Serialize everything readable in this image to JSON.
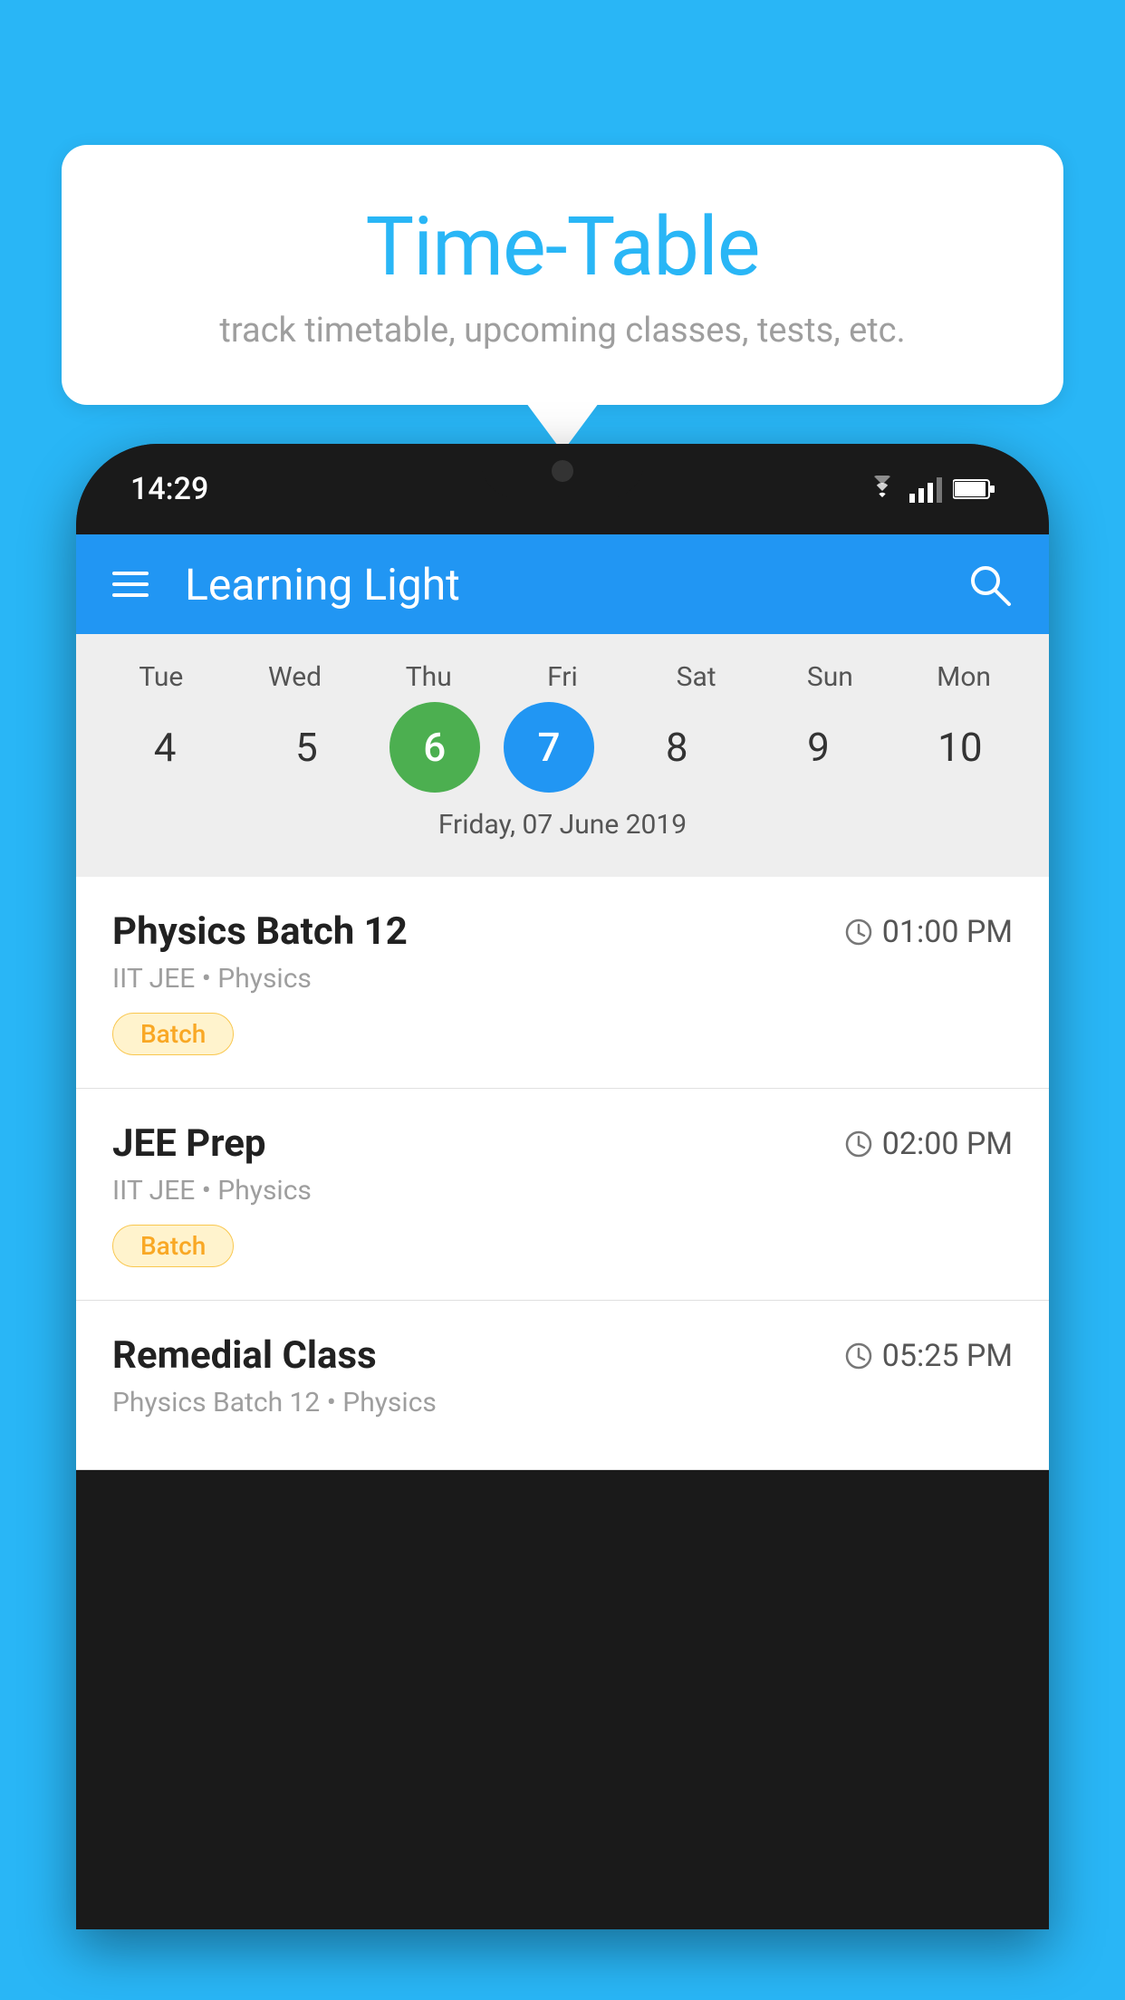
{
  "background_color": "#29B6F6",
  "bubble": {
    "title": "Time-Table",
    "subtitle": "track timetable, upcoming classes, tests, etc."
  },
  "phone": {
    "status_bar": {
      "time": "14:29"
    },
    "app_header": {
      "title": "Learning Light"
    },
    "calendar": {
      "days": [
        {
          "label": "Tue",
          "num": "4",
          "state": "normal"
        },
        {
          "label": "Wed",
          "num": "5",
          "state": "normal"
        },
        {
          "label": "Thu",
          "num": "6",
          "state": "today"
        },
        {
          "label": "Fri",
          "num": "7",
          "state": "selected"
        },
        {
          "label": "Sat",
          "num": "8",
          "state": "normal"
        },
        {
          "label": "Sun",
          "num": "9",
          "state": "normal"
        },
        {
          "label": "Mon",
          "num": "10",
          "state": "normal"
        }
      ],
      "selected_date_label": "Friday, 07 June 2019"
    },
    "schedule": [
      {
        "title": "Physics Batch 12",
        "time": "01:00 PM",
        "subtitle": "IIT JEE • Physics",
        "badge": "Batch"
      },
      {
        "title": "JEE Prep",
        "time": "02:00 PM",
        "subtitle": "IIT JEE • Physics",
        "badge": "Batch"
      },
      {
        "title": "Remedial Class",
        "time": "05:25 PM",
        "subtitle": "Physics Batch 12 • Physics",
        "badge": null
      }
    ]
  }
}
